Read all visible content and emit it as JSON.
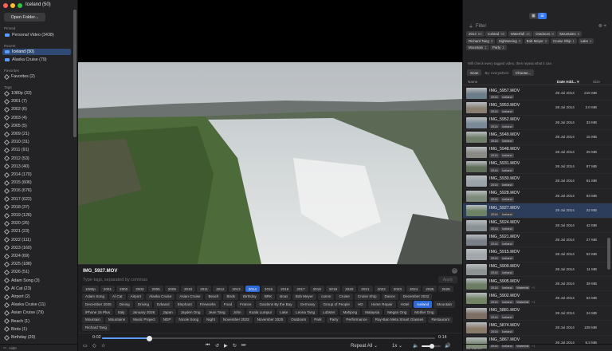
{
  "window": {
    "title": "Iceland (50)",
    "colors": {
      "close": "#ff5f57",
      "min": "#febc2e",
      "max": "#28c840",
      "accent": "#3478f6"
    }
  },
  "sidebar": {
    "open_folder_label": "Open Folder...",
    "pinned_label": "Pinned",
    "pinned": [
      {
        "label": "Personal Video (3438)"
      }
    ],
    "recent_label": "Recent",
    "recent": [
      {
        "label": "Iceland (50)",
        "selected": true
      },
      {
        "label": "Alaska Cruise (79)"
      }
    ],
    "favorites_label": "Favorites",
    "favorites": [
      {
        "label": "Favorites (2)"
      }
    ],
    "tags_label": "Tags",
    "tags": [
      "1080p (33)",
      "2001 (7)",
      "2002 (6)",
      "2003 (4)",
      "2005 (5)",
      "2009 (21)",
      "2010 (31)",
      "2011 (91)",
      "2012 (53)",
      "2013 (40)",
      "2014 (170)",
      "2015 (606)",
      "2016 (676)",
      "2017 (622)",
      "2018 (37)",
      "2019 (126)",
      "2020 (26)",
      "2021 (23)",
      "2022 (111)",
      "2023 (160)",
      "2024 (69)",
      "2025 (188)",
      "2026 (51)",
      "Adam Song (3)",
      "Al Cat (23)",
      "Airport (2)",
      "Alaska Cruise (11)",
      "Asian Cruise (79)",
      "Beach (1)",
      "Birds (1)",
      "Birthday (20)"
    ],
    "bottom_label": "Hide"
  },
  "editor": {
    "filename": "IMG_5927.MOV",
    "close_glyph": "×",
    "input_placeholder": "Type tags, separated by commas",
    "apply_label": "Apply",
    "tags": [
      "1080p",
      "2001",
      "2002",
      "2003",
      "2005",
      "2009",
      "2010",
      "2011",
      "2012",
      "2013",
      "2014",
      "2015",
      "2016",
      "2017",
      "2018",
      "2019",
      "2020",
      "2021",
      "2022",
      "2023",
      "2024",
      "2025",
      "2026",
      "Adam Song",
      "Al Cat",
      "Airport",
      "Alaska Cruise",
      "Asian Cruise",
      "Beach",
      "Birds",
      "Birthday",
      "BRK",
      "Boat",
      "Bob Meyer",
      "canon",
      "Cruise",
      "Cruise Ship",
      "Dance",
      "December 2022",
      "December 2025",
      "Dining",
      "Driving",
      "Edward",
      "Elephant",
      "Fireworks",
      "Food",
      "France",
      "Gardens By the Bay",
      "Germany",
      "Group of People",
      "HD",
      "Home Repair",
      "Hotel",
      "Iceland",
      "Mountain",
      "iPhone 16 Plus",
      "Italy",
      "January 2026",
      "Japan",
      "Jayden Ong",
      "Jean Tang",
      "John",
      "Kuala Lumpur",
      "Lake",
      "Leona Tang",
      "Lobster",
      "Mahjong",
      "Malaysia",
      "Megan Ong",
      "Mother Ong",
      "Mountain",
      "Mountains",
      "Music Project",
      "NDP",
      "Nicole Song",
      "Night",
      "November 2023",
      "November 2025",
      "Outdoors",
      "Park",
      "Party",
      "Performance",
      "Ray-Ban Meta Smart Glasses",
      "Restaurant",
      "Richard Tang"
    ],
    "active_tags": [
      "2014",
      "Iceland"
    ]
  },
  "player": {
    "current_time": "0:02",
    "duration": "0:14",
    "progress": 0.143,
    "volume": 0.55,
    "repeat_label": "Repeat All",
    "speed_label": "1x"
  },
  "right": {
    "view_toggle": [
      "▦",
      "☰"
    ],
    "filter_placeholder": "Filter",
    "filter_tags": [
      {
        "label": "2014",
        "count": "50"
      },
      {
        "label": "Iceland",
        "count": "50"
      },
      {
        "label": "Waterfall",
        "count": "16"
      },
      {
        "label": "Outdoors",
        "count": "8"
      },
      {
        "label": "Mountains",
        "count": "5"
      },
      {
        "label": "Richard Tang",
        "count": "3"
      },
      {
        "label": "Sightseeing",
        "count": "3"
      },
      {
        "label": "Bob Meyer",
        "count": "2"
      },
      {
        "label": "Cruise Ship",
        "count": "1"
      },
      {
        "label": "Lake",
        "count": "1"
      },
      {
        "label": "Mountain",
        "count": "1"
      },
      {
        "label": "Party",
        "count": "1"
      }
    ],
    "hint": "Will check every tagged video, then repeat what it can",
    "scan_label": "Scan",
    "scan_scope": "By: everywhere",
    "choose_label": "Choose...",
    "col_name": "Name",
    "col_date": "Date Add... ▾",
    "col_size": "Size",
    "rows": [
      {
        "name": "IMG_5957.MOV",
        "tags": [
          "2014",
          "Iceland"
        ],
        "more": "",
        "date": "28 Jul 2014",
        "size": "216 MB",
        "thumb": "#6c7c88"
      },
      {
        "name": "IMG_5953.MOV",
        "tags": [
          "2014",
          "Iceland"
        ],
        "more": "",
        "date": "28 Jul 2014",
        "size": "2.0 MB",
        "thumb": "#8a7f72"
      },
      {
        "name": "IMG_5952.MOV",
        "tags": [
          "2014",
          "Iceland"
        ],
        "more": "",
        "date": "28 Jul 2014",
        "size": "33 MB",
        "thumb": "#7a8a98"
      },
      {
        "name": "IMG_5949.MOV",
        "tags": [
          "2014",
          "Iceland"
        ],
        "more": "",
        "date": "28 Jul 2014",
        "size": "15 MB",
        "thumb": "#6f7d69"
      },
      {
        "name": "IMG_5948.MOV",
        "tags": [
          "2014",
          "Iceland"
        ],
        "more": "",
        "date": "28 Jul 2014",
        "size": "29 MB",
        "thumb": "#8b8b86"
      },
      {
        "name": "IMG_5931.MOV",
        "tags": [
          "2014",
          "Iceland"
        ],
        "more": "",
        "date": "28 Jul 2014",
        "size": "87 MB",
        "thumb": "#5f6e58"
      },
      {
        "name": "IMG_5930.MOV",
        "tags": [
          "2014",
          "Iceland"
        ],
        "more": "",
        "date": "28 Jul 2014",
        "size": "61 MB",
        "thumb": "#9aa3a8"
      },
      {
        "name": "IMG_5928.MOV",
        "tags": [
          "2014",
          "Iceland"
        ],
        "more": "",
        "date": "28 Jul 2014",
        "size": "93 MB",
        "thumb": "#7e8a7a"
      },
      {
        "name": "IMG_5927.MOV",
        "tags": [
          "2014",
          "Iceland"
        ],
        "more": "",
        "date": "28 Jul 2014",
        "size": "22 MB",
        "thumb": "#6d8163",
        "selected": true
      },
      {
        "name": "IMG_5924.MOV",
        "tags": [
          "2014",
          "Iceland"
        ],
        "more": "",
        "date": "28 Jul 2014",
        "size": "42 MB",
        "thumb": "#8b9296"
      },
      {
        "name": "IMG_5921.MOV",
        "tags": [
          "2014",
          "Iceland"
        ],
        "more": "",
        "date": "28 Jul 2014",
        "size": "27 MB",
        "thumb": "#7a8088"
      },
      {
        "name": "IMG_5915.MOV",
        "tags": [
          "2014",
          "Iceland"
        ],
        "more": "",
        "date": "28 Jul 2014",
        "size": "52 MB",
        "thumb": "#a0a6a9"
      },
      {
        "name": "IMG_5909.MOV",
        "tags": [
          "2014",
          "Iceland"
        ],
        "more": "",
        "date": "28 Jul 2014",
        "size": "11 MB",
        "thumb": "#8e9493"
      },
      {
        "name": "IMG_5905.MOV",
        "tags": [
          "2014",
          "Iceland",
          "Waterfall"
        ],
        "more": "+2",
        "date": "28 Jul 2014",
        "size": "39 MB",
        "thumb": "#6b7d62"
      },
      {
        "name": "IMG_5902.MOV",
        "tags": [
          "2014",
          "Iceland",
          "Waterfall"
        ],
        "more": "+1",
        "date": "28 Jul 2014",
        "size": "64 MB",
        "thumb": "#748566"
      },
      {
        "name": "IMG_5881.MOV",
        "tags": [
          "2014",
          "Iceland"
        ],
        "more": "",
        "date": "28 Jul 2014",
        "size": "24 MB",
        "thumb": "#7c6e62"
      },
      {
        "name": "IMG_5874.MOV",
        "tags": [
          "2014",
          "Iceland"
        ],
        "more": "",
        "date": "28 Jul 2014",
        "size": "108 MB",
        "thumb": "#8a7a6a"
      },
      {
        "name": "IMG_5867.MOV",
        "tags": [
          "2014",
          "Iceland",
          "Waterfall"
        ],
        "more": "+1",
        "date": "28 Jul 2014",
        "size": "8.3 MB",
        "thumb": "#7c8a76"
      }
    ],
    "footer": "50 videos"
  }
}
